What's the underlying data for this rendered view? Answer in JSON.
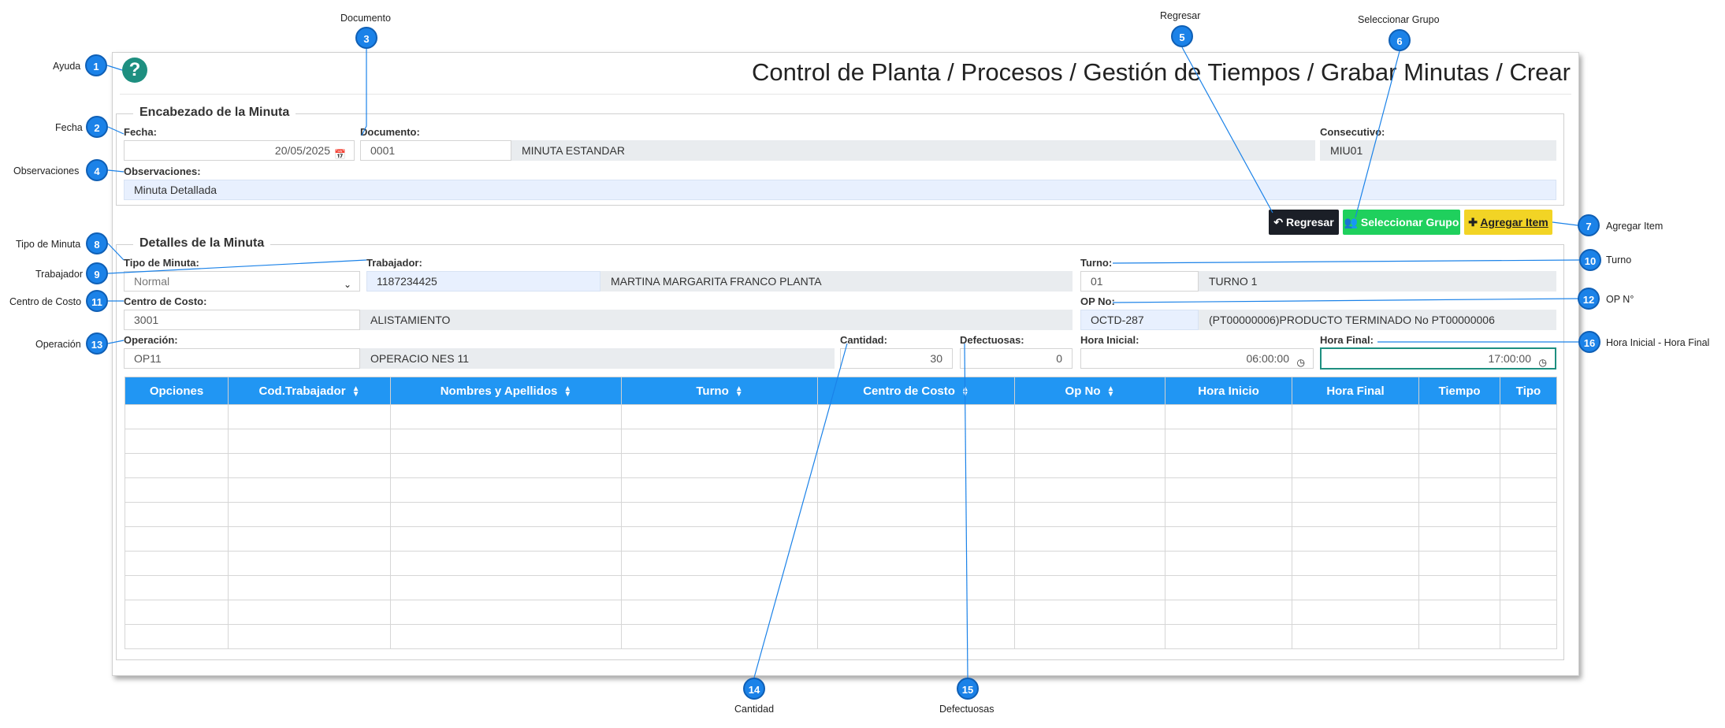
{
  "page": {
    "title": "Control de Planta / Procesos / Gestión de Tiempos / Grabar Minutas / Crear",
    "help_icon": "?",
    "accent_color": "#1e8f80",
    "header_color": "#2196f3"
  },
  "header_section": {
    "legend": "Encabezado de la Minuta",
    "fecha": {
      "label": "Fecha:",
      "value": "20/05/2025"
    },
    "documento": {
      "label": "Documento:",
      "code": "0001",
      "name": "MINUTA ESTANDAR"
    },
    "consecutivo": {
      "label": "Consecutivo:",
      "value": "MIU01"
    },
    "observaciones": {
      "label": "Observaciones:",
      "value": "Minuta Detallada"
    }
  },
  "actions": {
    "regresar": "Regresar",
    "seleccionar_grupo": "Seleccionar Grupo",
    "agregar_item": "Agregar Item"
  },
  "details_section": {
    "legend": "Detalles de la Minuta",
    "tipo_minuta": {
      "label": "Tipo de Minuta:",
      "value": "Normal"
    },
    "trabajador": {
      "label": "Trabajador:",
      "code": "1187234425",
      "name": "MARTINA MARGARITA FRANCO PLANTA"
    },
    "turno": {
      "label": "Turno:",
      "code": "01",
      "name": "TURNO 1"
    },
    "centro_costo": {
      "label": "Centro de Costo:",
      "code": "3001",
      "name": "ALISTAMIENTO"
    },
    "op_no": {
      "label": "OP No:",
      "code": "OCTD-287",
      "name": "(PT00000006)PRODUCTO TERMINADO No PT00000006"
    },
    "operacion": {
      "label": "Operación:",
      "code": "OP11",
      "name": "OPERACIO NES 11"
    },
    "cantidad": {
      "label": "Cantidad:",
      "value": "30"
    },
    "defectuosas": {
      "label": "Defectuosas:",
      "value": "0"
    },
    "hora_inicial": {
      "label": "Hora Inicial:",
      "value": "06:00:00"
    },
    "hora_final": {
      "label": "Hora Final:",
      "value": "17:00:00"
    }
  },
  "table": {
    "columns": [
      {
        "label": "Opciones",
        "sortable": false
      },
      {
        "label": "Cod.Trabajador",
        "sortable": true
      },
      {
        "label": "Nombres y Apellidos",
        "sortable": true
      },
      {
        "label": "Turno",
        "sortable": true
      },
      {
        "label": "Centro de Costo",
        "sortable": true
      },
      {
        "label": "Op No",
        "sortable": true
      },
      {
        "label": "Hora Inicio",
        "sortable": false
      },
      {
        "label": "Hora Final",
        "sortable": false
      },
      {
        "label": "Tiempo",
        "sortable": false
      },
      {
        "label": "Tipo",
        "sortable": false
      }
    ],
    "empty_rows": 10
  },
  "callouts": [
    {
      "num": "1",
      "text": "Ayuda"
    },
    {
      "num": "2",
      "text": "Fecha"
    },
    {
      "num": "3",
      "text": "Documento"
    },
    {
      "num": "4",
      "text": "Observaciones"
    },
    {
      "num": "5",
      "text": "Regresar"
    },
    {
      "num": "6",
      "text": "Seleccionar Grupo"
    },
    {
      "num": "7",
      "text": "Agregar Item"
    },
    {
      "num": "8",
      "text": "Tipo de Minuta"
    },
    {
      "num": "9",
      "text": "Trabajador"
    },
    {
      "num": "10",
      "text": "Turno"
    },
    {
      "num": "11",
      "text": "Centro de Costo"
    },
    {
      "num": "12",
      "text": "OP N°"
    },
    {
      "num": "13",
      "text": "Operación"
    },
    {
      "num": "14",
      "text": "Cantidad"
    },
    {
      "num": "15",
      "text": "Defectuosas"
    },
    {
      "num": "16",
      "text": "Hora Inicial -  Hora Final"
    }
  ],
  "callout_color": "#1b82e8"
}
